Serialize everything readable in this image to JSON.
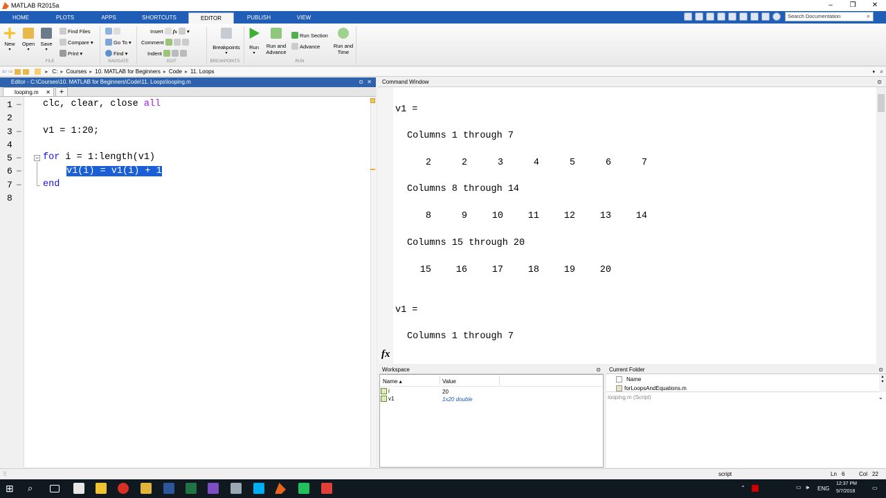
{
  "window": {
    "title": "MATLAB R2015a",
    "controls": [
      "–",
      "❐",
      "✕"
    ]
  },
  "ribbon_tabs": [
    "HOME",
    "PLOTS",
    "APPS",
    "SHORTCUTS",
    "EDITOR",
    "PUBLISH",
    "VIEW"
  ],
  "active_tab": "EDITOR",
  "search_placeholder": "Search Documentation",
  "ribbon": {
    "new": "New",
    "open": "Open",
    "save": "Save",
    "find_files": "Find Files",
    "compare": "Compare",
    "print": "Print",
    "go_to": "Go To",
    "find": "Find",
    "insert": "Insert",
    "comment": "Comment",
    "indent": "Indent",
    "breakpoints": "Breakpoints",
    "run": "Run",
    "run_and_advance_1": "Run and",
    "run_and_advance_2": "Advance",
    "run_section": "Run Section",
    "advance": "Advance",
    "run_and_time_1": "Run and",
    "run_and_time_2": "Time",
    "groups": {
      "file": "FILE",
      "navigate": "NAVIGATE",
      "edit": "EDIT",
      "breakpoints": "BREAKPOINTS",
      "run": "RUN"
    }
  },
  "path": [
    "C:",
    "Courses",
    "10. MATLAB for Beginners",
    "Code",
    "11. Loops"
  ],
  "editor": {
    "title": "Editor - C:\\Courses\\10. MATLAB for Beginners\\Code\\11. Loops\\looping.m",
    "tab": "looping.m",
    "lines": [
      "1",
      "2",
      "3",
      "4",
      "5",
      "6",
      "7",
      "8"
    ],
    "code": {
      "l1a": "clc, clear, close ",
      "l1b": "all",
      "l3": "v1 = 1:20;",
      "l5a": "for",
      "l5b": " i = 1:length(v1)",
      "l6": "v1(i) = v1(i) + 1",
      "l7": "end"
    }
  },
  "command_window": {
    "title": "Command Window",
    "var1": "v1 =",
    "cols1": "Columns 1 through 7",
    "row1": [
      "2",
      "2",
      "3",
      "4",
      "5",
      "6",
      "7"
    ],
    "cols2": "Columns 8 through 14",
    "row2": [
      "8",
      "9",
      "10",
      "11",
      "12",
      "13",
      "14"
    ],
    "cols3": "Columns 15 through 20",
    "row3": [
      "15",
      "16",
      "17",
      "18",
      "19",
      "20"
    ],
    "var2": "v1 =",
    "cols4": "Columns 1 through 7",
    "prompt": "fx"
  },
  "workspace": {
    "title": "Workspace",
    "col_name": "Name ▴",
    "col_value": "Value",
    "rows": [
      {
        "name": "i",
        "value": "20"
      },
      {
        "name": "v1",
        "value": "1x20 double"
      }
    ]
  },
  "current_folder": {
    "title": "Current Folder",
    "col_name": "Name",
    "file": "forLoopsAndEquations.m",
    "details": "looping.m (Script)"
  },
  "status": {
    "mode": "script",
    "ln_label": "Ln",
    "ln": "6",
    "col_label": "Col",
    "col": "22"
  },
  "tray": {
    "lang": "ENG",
    "time": "12:37 PM",
    "date": "5/7/2018"
  }
}
